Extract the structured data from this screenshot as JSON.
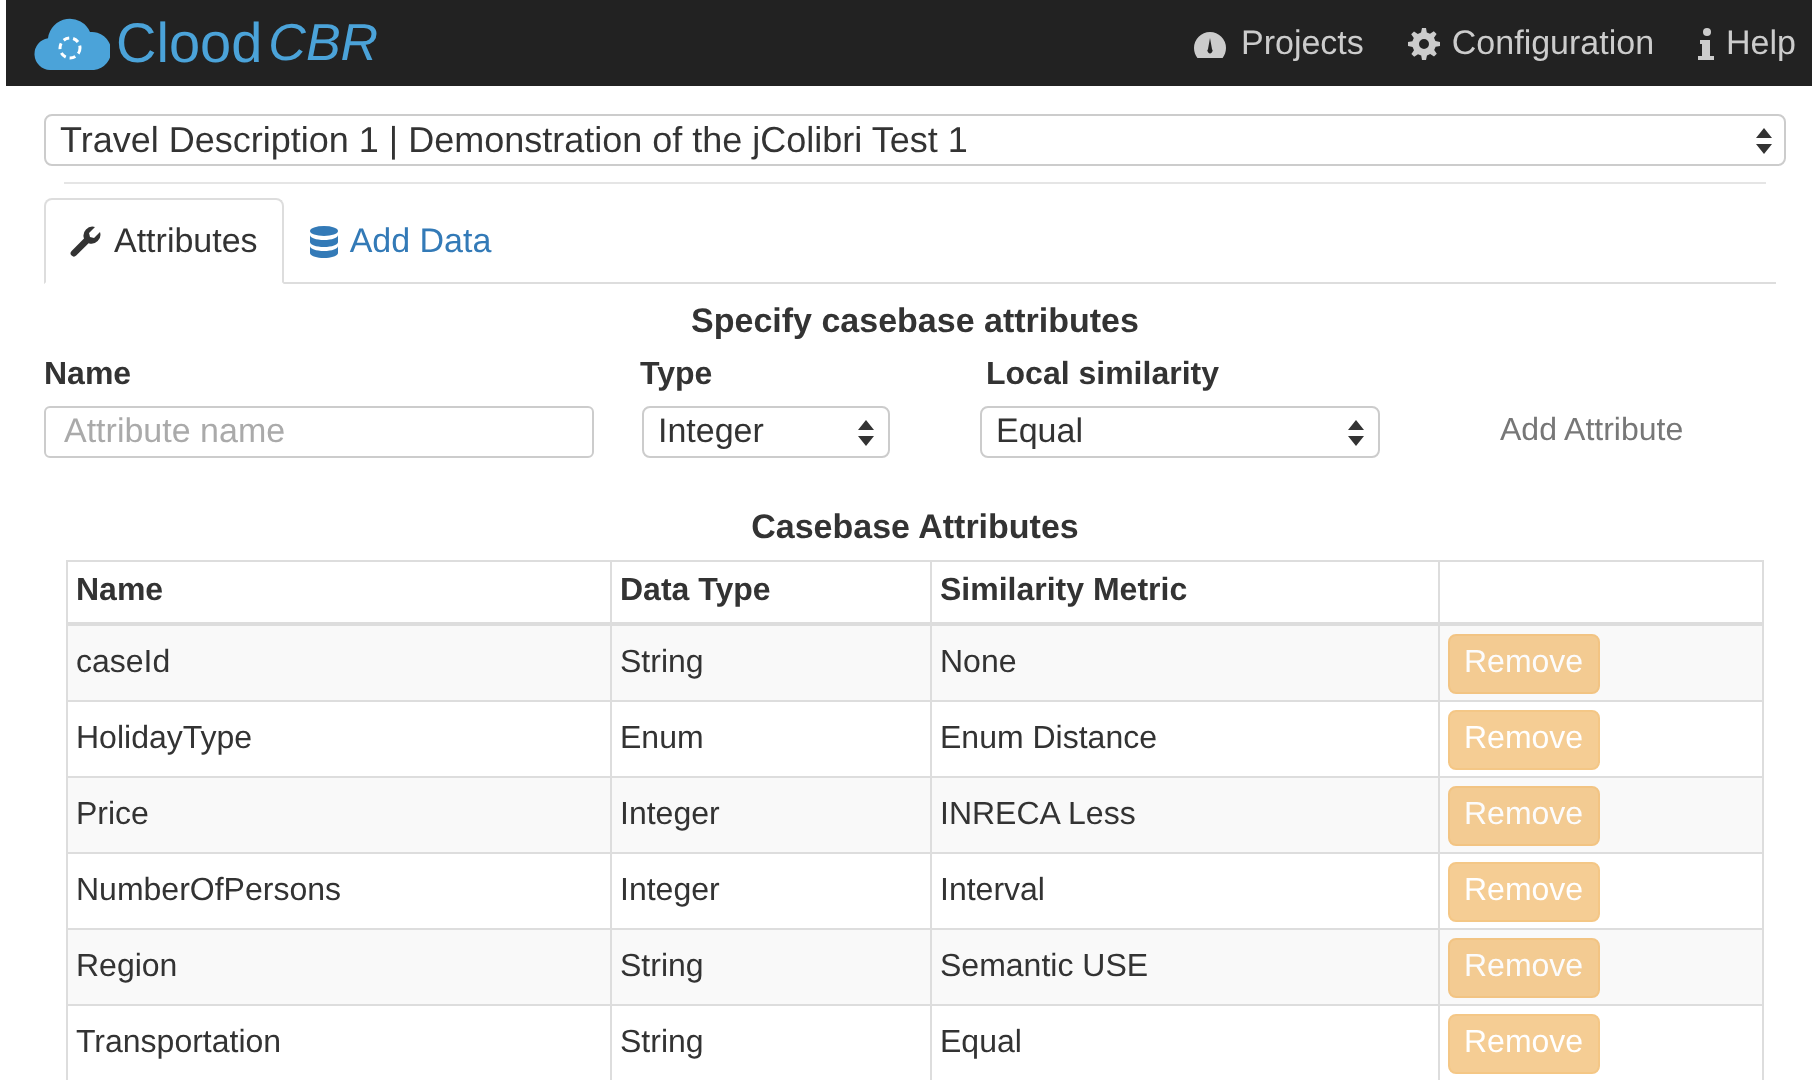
{
  "navbar": {
    "brand": "Clood",
    "brand_suffix": "CBR",
    "links": [
      {
        "kind": "dashboard",
        "label": "Projects"
      },
      {
        "kind": "gear",
        "label": "Configuration"
      },
      {
        "kind": "info",
        "label": "Help"
      }
    ]
  },
  "project_select": {
    "value": "Travel Description 1 | Demonstration of the jColibri Test 1"
  },
  "tabs": [
    {
      "kind": "wrench",
      "label": "Attributes",
      "selected": true
    },
    {
      "kind": "database",
      "label": "Add Data",
      "selected": false
    }
  ],
  "form": {
    "title": "Specify casebase attributes",
    "name_label": "Name",
    "name_placeholder": "Attribute name",
    "type_label": "Type",
    "type_value": "Integer",
    "similarity_label": "Local similarity",
    "similarity_value": "Equal",
    "add_button": {
      "label": "Add Attribute",
      "disabled": true
    }
  },
  "table": {
    "title": "Casebase Attributes",
    "columns": [
      "Name",
      "Data Type",
      "Similarity Metric"
    ],
    "rows": [
      {
        "name": "caseId",
        "type": "String",
        "metric": "None",
        "button": {
          "label": "Remove",
          "disabled": true
        }
      },
      {
        "name": "HolidayType",
        "type": "Enum",
        "metric": "Enum Distance",
        "button": {
          "label": "Remove",
          "disabled": true
        }
      },
      {
        "name": "Price",
        "type": "Integer",
        "metric": "INRECA Less",
        "button": {
          "label": "Remove",
          "disabled": true
        }
      },
      {
        "name": "NumberOfPersons",
        "type": "Integer",
        "metric": "Interval",
        "button": {
          "label": "Remove",
          "disabled": true
        }
      },
      {
        "name": "Region",
        "type": "String",
        "metric": "Semantic USE",
        "button": {
          "label": "Remove",
          "disabled": true
        }
      },
      {
        "name": "Transportation",
        "type": "String",
        "metric": "Equal",
        "button": {
          "label": "Remove",
          "disabled": true
        }
      }
    ]
  }
}
